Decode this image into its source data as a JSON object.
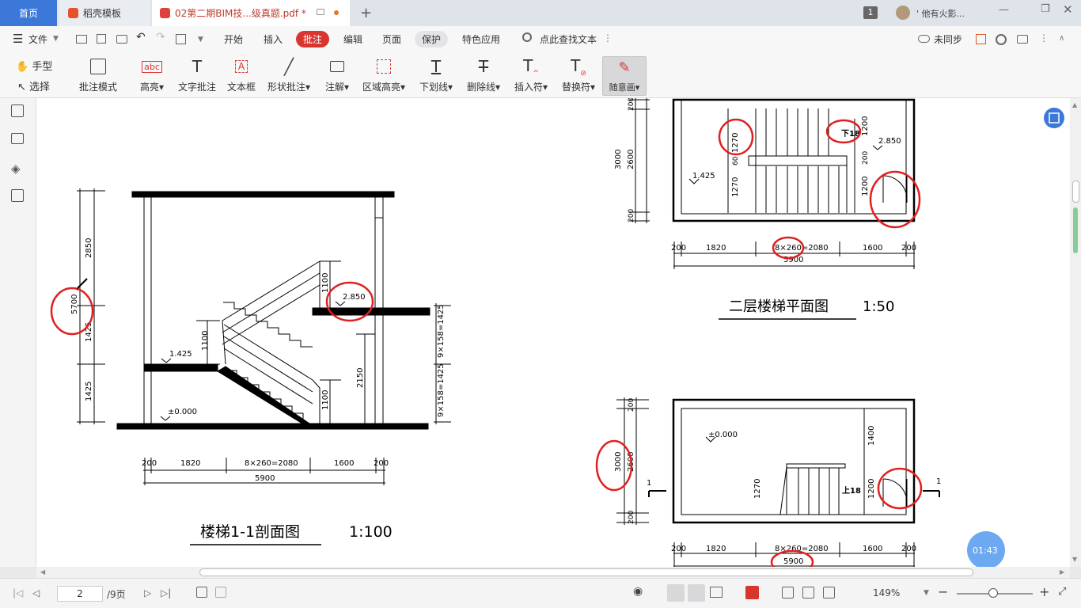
{
  "tabs": {
    "home": "首页",
    "template": "稻壳模板",
    "document": "02第二期BIM技...级真题.pdf *",
    "add": "+"
  },
  "titlebar": {
    "counter": "1",
    "user": "' 他有火影..."
  },
  "menu": {
    "file": "文件",
    "items": [
      "开始",
      "插入",
      "批注",
      "编辑",
      "页面",
      "保护",
      "特色应用"
    ],
    "search": "点此查找文本",
    "sync": "未同步"
  },
  "left_tools": {
    "hand": "手型",
    "select": "选择"
  },
  "ribbon": [
    "批注模式",
    "高亮",
    "文字批注",
    "文本框",
    "形状批注",
    "注解",
    "区域高亮",
    "下划线",
    "删除线",
    "插入符",
    "替换符",
    "随意画"
  ],
  "drawing": {
    "section_title": "楼梯1-1剖面图",
    "section_scale": "1:100",
    "plan2_title": "二层楼梯平面图",
    "plan2_scale": "1:50",
    "section_dims": {
      "left": [
        "2850",
        "5700",
        "1425",
        "1425"
      ],
      "inner": [
        "1100",
        "1100",
        "1100",
        "2150"
      ],
      "right": [
        "9×158=1425",
        "9×158=1425"
      ],
      "bottom": [
        "200",
        "1820",
        "8×260=2080",
        "1600",
        "200"
      ],
      "total": "5900",
      "elevations": [
        "2.850",
        "1.425",
        "±0.000"
      ]
    },
    "plan2_dims": {
      "left": [
        "200",
        "3000",
        "2600",
        "200"
      ],
      "inner": [
        "1270",
        "60",
        "1270",
        "1200",
        "200",
        "1200"
      ],
      "bottom": [
        "200",
        "1820",
        "8×260=2080",
        "1600",
        "200"
      ],
      "total": "5900",
      "label_down": "下18",
      "elevations": [
        "2.850",
        "1.425"
      ]
    },
    "plan1_dims": {
      "left": [
        "200",
        "3000",
        "2600",
        "200"
      ],
      "inner": [
        "1400",
        "1270",
        "1200"
      ],
      "bottom": [
        "200",
        "1820",
        "8×260=2080",
        "1600",
        "200"
      ],
      "total": "5900",
      "label_up": "上18",
      "elevation": "±0.000",
      "section_mark": "1"
    },
    "clock": "01:43"
  },
  "status": {
    "page": "2",
    "total": "/9页",
    "zoom": "149%"
  },
  "colors": {
    "accent": "#d9352f",
    "home_tab": "#3c78d8",
    "annotation": "#e02020"
  }
}
